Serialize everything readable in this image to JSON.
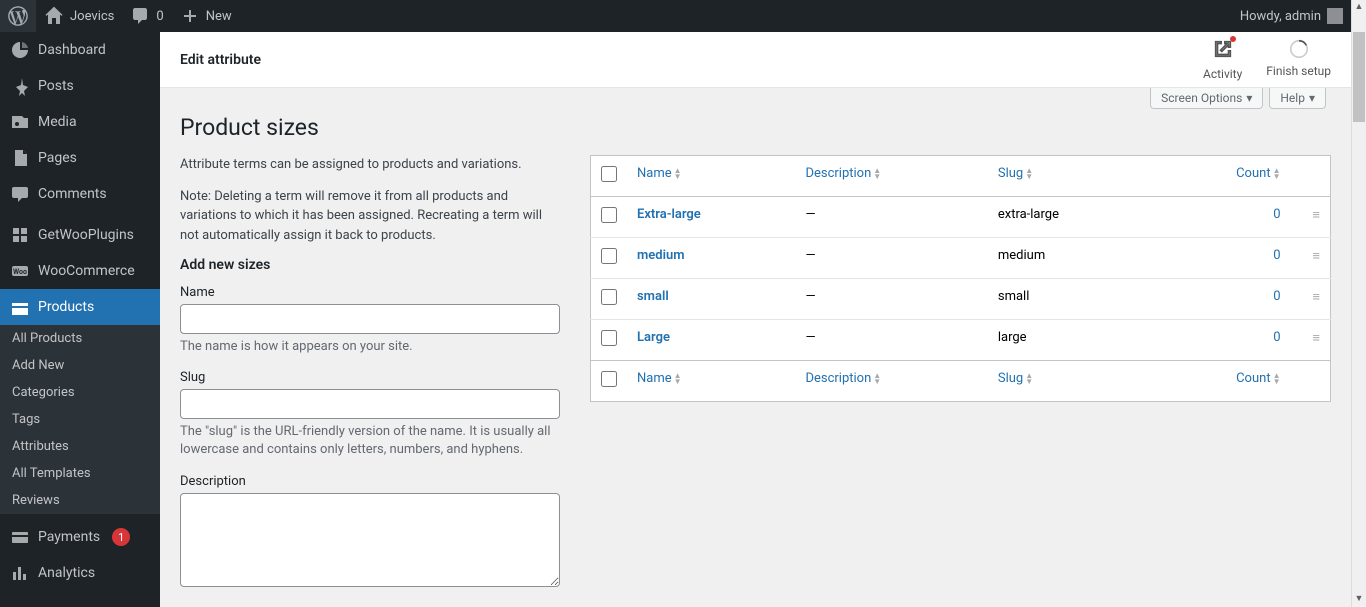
{
  "adminbar": {
    "site_name": "Joevics",
    "comments_count": "0",
    "new_label": "New",
    "howdy": "Howdy, admin"
  },
  "sidebar": {
    "items": [
      {
        "id": "dashboard",
        "label": "Dashboard",
        "icon": "dashboard"
      },
      {
        "id": "posts",
        "label": "Posts",
        "icon": "pin"
      },
      {
        "id": "media",
        "label": "Media",
        "icon": "media"
      },
      {
        "id": "pages",
        "label": "Pages",
        "icon": "pages"
      },
      {
        "id": "comments",
        "label": "Comments",
        "icon": "comments"
      },
      {
        "id": "getwoo",
        "label": "GetWooPlugins",
        "icon": "grid"
      },
      {
        "id": "woocommerce",
        "label": "WooCommerce",
        "icon": "woo"
      },
      {
        "id": "products",
        "label": "Products",
        "icon": "products",
        "active": true
      },
      {
        "id": "payments",
        "label": "Payments",
        "icon": "payments",
        "badge": "1"
      },
      {
        "id": "analytics",
        "label": "Analytics",
        "icon": "analytics"
      }
    ],
    "products_sub": [
      "All Products",
      "Add New",
      "Categories",
      "Tags",
      "Attributes",
      "All Templates",
      "Reviews"
    ]
  },
  "header": {
    "title": "Edit attribute",
    "activity": "Activity",
    "finish": "Finish setup"
  },
  "tabs": {
    "screen_options": "Screen Options",
    "help": "Help"
  },
  "page": {
    "h1": "Product sizes",
    "intro": "Attribute terms can be assigned to products and variations.",
    "note": "Note: Deleting a term will remove it from all products and variations to which it has been assigned. Recreating a term will not automatically assign it back to products.",
    "add_h2": "Add new sizes",
    "name_label": "Name",
    "name_help": "The name is how it appears on your site.",
    "slug_label": "Slug",
    "slug_help": "The \"slug\" is the URL-friendly version of the name. It is usually all lowercase and contains only letters, numbers, and hyphens.",
    "desc_label": "Description"
  },
  "table": {
    "cols": {
      "name": "Name",
      "description": "Description",
      "slug": "Slug",
      "count": "Count"
    },
    "rows": [
      {
        "name": "Extra-large",
        "description": "—",
        "slug": "extra-large",
        "count": "0"
      },
      {
        "name": "medium",
        "description": "—",
        "slug": "medium",
        "count": "0"
      },
      {
        "name": "small",
        "description": "—",
        "slug": "small",
        "count": "0"
      },
      {
        "name": "Large",
        "description": "—",
        "slug": "large",
        "count": "0"
      }
    ]
  }
}
